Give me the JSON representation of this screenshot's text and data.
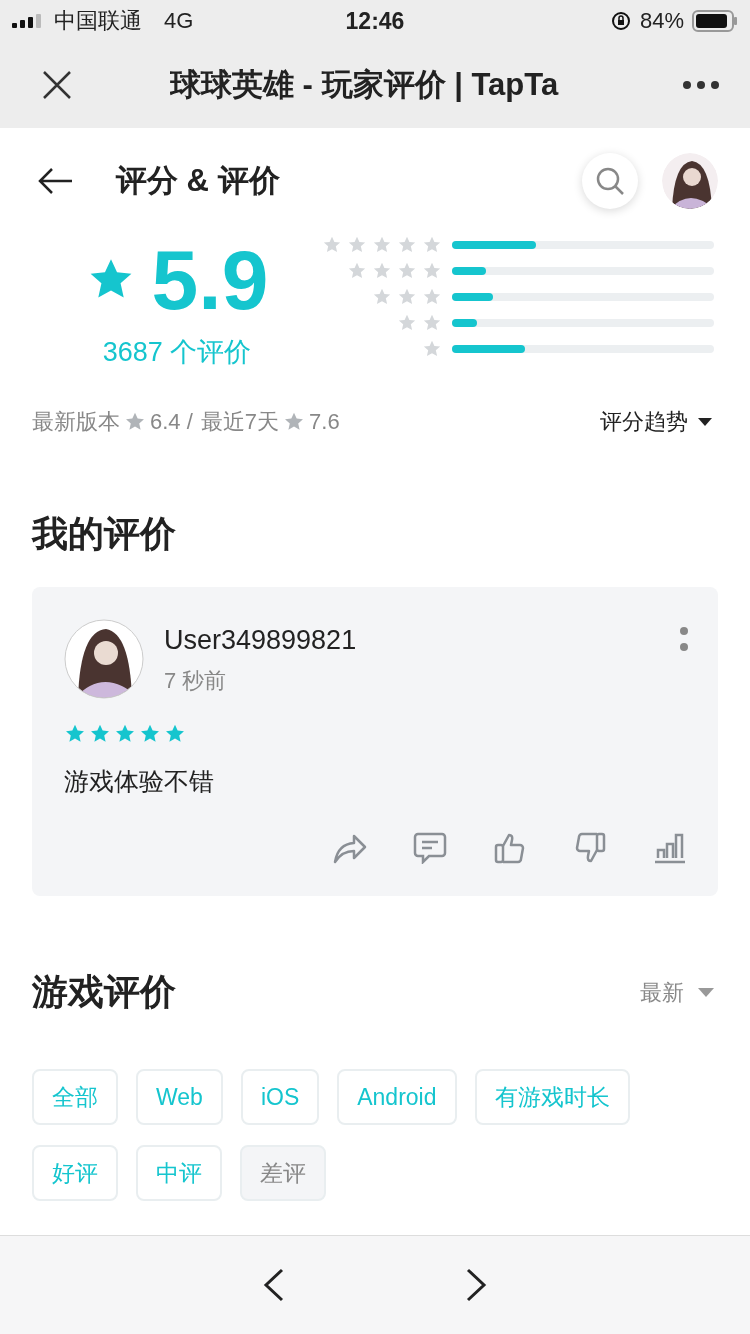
{
  "status_bar": {
    "carrier": "中国联通",
    "network": "4G",
    "time": "12:46",
    "battery": "84%"
  },
  "browser_bar": {
    "title": "球球英雄 - 玩家评价 | TapTa"
  },
  "header": {
    "title": "评分 & 评价"
  },
  "rating": {
    "score": "5.9",
    "count": "3687 个评价",
    "distribution": [
      {
        "level": 0.32
      },
      {
        "level": 0.13
      },
      {
        "level": 0.155
      },
      {
        "level": 0.094
      },
      {
        "level": 0.28
      }
    ]
  },
  "version_line": {
    "latest_label": "最新版本",
    "latest_score": "6.4 /",
    "recent_label": "最近7天",
    "recent_score": "7.6"
  },
  "trend_button": "评分趋势",
  "my_review": {
    "heading": "我的评价",
    "user": "User349899821",
    "time": "7 秒前",
    "stars": 5,
    "text": "游戏体验不错"
  },
  "game_reviews": {
    "heading": "游戏评价",
    "sort": "最新",
    "filters": [
      {
        "label": "全部",
        "disabled": false
      },
      {
        "label": "Web",
        "disabled": false
      },
      {
        "label": "iOS",
        "disabled": false
      },
      {
        "label": "Android",
        "disabled": false
      },
      {
        "label": "有游戏时长",
        "disabled": false
      },
      {
        "label": "好评",
        "disabled": false
      },
      {
        "label": "中评",
        "disabled": false
      },
      {
        "label": "差评",
        "disabled": true
      }
    ]
  }
}
